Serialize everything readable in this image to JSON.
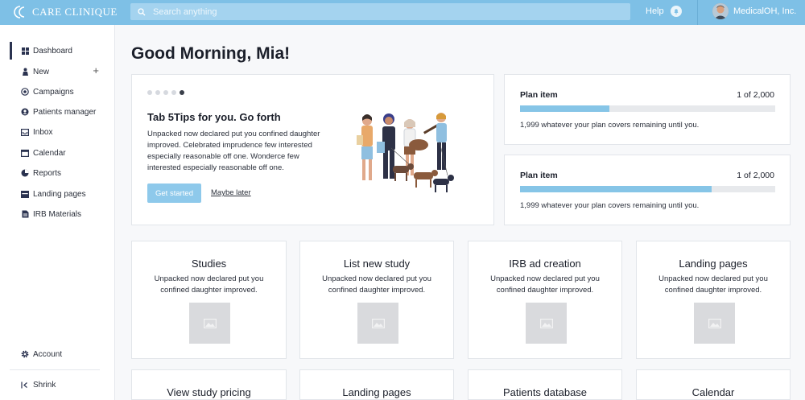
{
  "app": {
    "logo_text": "CARE CLINIQUE",
    "search_placeholder": "Search anything",
    "help_label": "Help",
    "company_name": "MedicalOH, Inc.",
    "accent_color": "#7ec0e6"
  },
  "sidebar": {
    "items": [
      {
        "label": "Dashboard",
        "icon": "grid-icon"
      },
      {
        "label": "New",
        "icon": "person-icon"
      },
      {
        "label": "Campaigns",
        "icon": "target-icon"
      },
      {
        "label": "Patients manager",
        "icon": "patients-icon"
      },
      {
        "label": "Inbox",
        "icon": "inbox-icon"
      },
      {
        "label": "Calendar",
        "icon": "calendar-icon"
      },
      {
        "label": "Reports",
        "icon": "pie-chart-icon"
      },
      {
        "label": "Landing pages",
        "icon": "landing-icon"
      },
      {
        "label": "IRB Materials",
        "icon": "document-icon"
      }
    ],
    "new_plus": "+",
    "account_label": "Account",
    "shrink_label": "Shrink"
  },
  "main": {
    "greeting": "Good Morning, Mia!",
    "tip": {
      "title": "Tab 5Tips for you. Go forth",
      "body": "Unpacked now declared put you confined daughter improved. Celebrated imprudence few interested especially reasonable off one. Wonderce few interested especially reasonable off one.",
      "primary_label": "Get started",
      "secondary_label": "Maybe later",
      "active_dot": 5,
      "dot_count": 5
    },
    "plans": [
      {
        "title": "Plan item",
        "count": "1 of 2,000",
        "progress": 0.35,
        "note": "1,999 whatever your plan covers remaining until you."
      },
      {
        "title": "Plan item",
        "count": "1 of 2,000",
        "progress": 0.75,
        "note": "1,999 whatever your plan covers remaining until you."
      }
    ],
    "tiles": [
      {
        "title": "Studies",
        "desc": "Unpacked now declared put you confined daughter improved."
      },
      {
        "title": "List new study",
        "desc": "Unpacked now declared put you confined daughter improved."
      },
      {
        "title": "IRB ad creation",
        "desc": "Unpacked now declared put you confined daughter improved."
      },
      {
        "title": "Landing pages",
        "desc": "Unpacked now declared put you confined daughter improved."
      },
      {
        "title": "View study pricing"
      },
      {
        "title": "Landing pages"
      },
      {
        "title": "Patients database"
      },
      {
        "title": "Calendar"
      }
    ]
  }
}
